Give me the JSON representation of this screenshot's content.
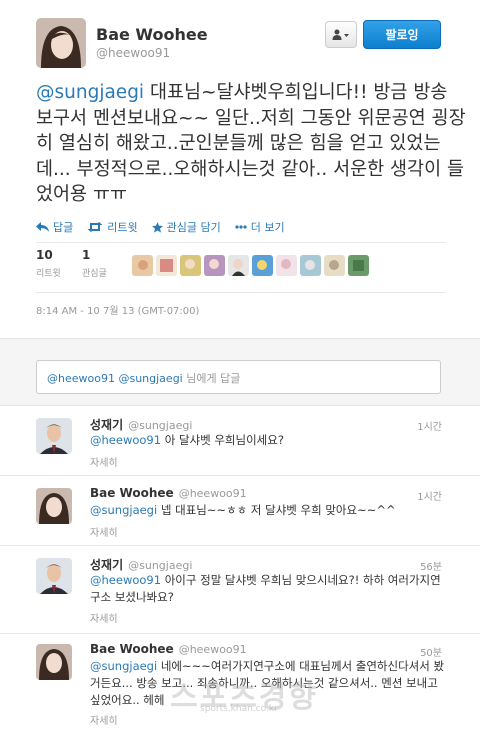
{
  "profile": {
    "name": "Bae Woohee",
    "handle": "@heewoo91",
    "follow_label": "팔로잉"
  },
  "tweet": {
    "mention": "@sungjaegi",
    "text": " 대표님~달샤벳우희입니다!! 방금 방송 보구서 멘션보내요~~ 일단..저희 그동안 위문공연 굉장히 열심히 해왔고..군인분들께 많은 힘을 얻고 있었는데... 부정적으로..오해하시는것 같아.. 서운한 생각이 들었어용 ㅠㅠ"
  },
  "actions": [
    {
      "icon": "reply-icon",
      "label": "답글"
    },
    {
      "icon": "retweet-icon",
      "label": "리트윗"
    },
    {
      "icon": "star-icon",
      "label": "관심글 담기"
    },
    {
      "icon": "more-icon",
      "label": "더 보기"
    }
  ],
  "stats": [
    {
      "num": "10",
      "label": "리트윗"
    },
    {
      "num": "1",
      "label": "관심글"
    }
  ],
  "timestamp": "8:14 AM - 10 7월 13 (GMT-07:00)",
  "reply_box": {
    "mention1": "@heewoo91",
    "mention2": "@sungjaegi",
    "suffix": " 님에게 답글"
  },
  "replies": [
    {
      "name": "성재기",
      "handle": "@sungjaegi",
      "time": "1시간",
      "mention": "@heewoo91",
      "text": " 아 달샤벳 우희님이세요?",
      "more": "자세히"
    },
    {
      "name": "Bae Woohee",
      "handle": "@heewoo91",
      "time": "1시간",
      "mention": "@sungjaegi",
      "text": " 넵 대표님~~ㅎㅎ 저 달샤벳 우희 맞아요~~^^",
      "more": "자세히"
    },
    {
      "name": "성재기",
      "handle": "@sungjaegi",
      "time": "56분",
      "mention": "@heewoo91",
      "text": " 아이구 정말 달샤벳 우희님 맞으시네요?! 하하 여러가지연구소 보셨나봐요?",
      "more": "자세히"
    },
    {
      "name": "Bae Woohee",
      "handle": "@heewoo91",
      "time": "50분",
      "mention": "@sungjaegi",
      "text": " 네에~~~여러가지연구소에 대표님께서 출연하신다셔서 봤거든요... 방송 보고... 죄송하니까.. 오해하시는것 같으셔서.. 멘션 보내고 싶었어요.. 헤헤",
      "more": "자세히"
    }
  ],
  "watermark": {
    "text": "스포츠경향",
    "url": "sports.khan.co.kr"
  }
}
